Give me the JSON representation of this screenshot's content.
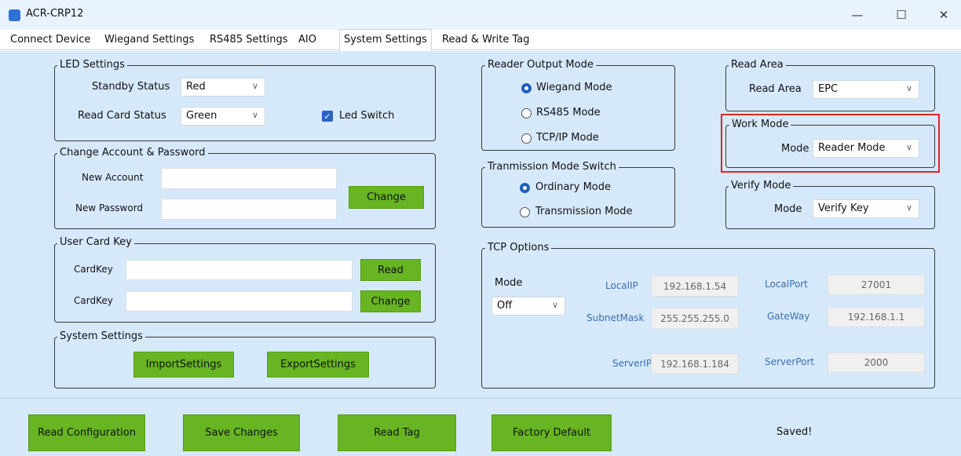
{
  "window": {
    "title": "ACR-CRP12",
    "minimize": "—",
    "maximize": "☐",
    "close": "✕"
  },
  "tabs": [
    "Connect Device",
    "Wiegand Settings",
    "RS485 Settings",
    "AIO",
    "System Settings",
    "Read & Write Tag"
  ],
  "active_tab": "System Settings",
  "led": {
    "title": "LED Settings",
    "standby_label": "Standby Status",
    "standby_value": "Red",
    "read_label": "Read Card Status",
    "read_value": "Green",
    "switch_label": "Led Switch",
    "switch_checked": true
  },
  "account": {
    "title": "Change Account & Password",
    "new_account_label": "New Account",
    "new_account_value": "",
    "new_password_label": "New Password",
    "new_password_value": "",
    "change_button": "Change"
  },
  "cardkey": {
    "title": "User Card Key",
    "label1": "CardKey",
    "value1": "",
    "read_button": "Read",
    "label2": "CardKey",
    "value2": "",
    "change_button": "Change"
  },
  "system": {
    "title": "System Settings",
    "import_button": "ImportSettings",
    "export_button": "ExportSettings"
  },
  "output_mode": {
    "title": "Reader Output Mode",
    "options": [
      "Wiegand Mode",
      "RS485 Mode",
      "TCP/IP Mode"
    ],
    "selected": "Wiegand Mode"
  },
  "transmission": {
    "title": "Tranmission Mode Switch",
    "options": [
      "Ordinary Mode",
      "Transmission Mode"
    ],
    "selected": "Ordinary Mode"
  },
  "read_area": {
    "title": "Read Area",
    "label": "Read Area",
    "value": "EPC"
  },
  "work_mode": {
    "title": "Work Mode",
    "label": "Mode",
    "value": "Reader Mode",
    "highlight_color": "#e0242c"
  },
  "verify_mode": {
    "title": "Verify Mode",
    "label": "Mode",
    "value": "Verify Key"
  },
  "tcp": {
    "title": "TCP Options",
    "mode_label": "Mode",
    "mode_value": "Off",
    "local_ip_label": "LocalIP",
    "local_ip": "192.168.1.54",
    "local_port_label": "LocalPort",
    "local_port": "27001",
    "subnet_label": "SubnetMask",
    "subnet": "255.255.255.0",
    "gateway_label": "GateWay",
    "gateway": "192.168.1.1",
    "server_ip_label": "ServerIP",
    "server_ip": "192.168.1.184",
    "server_port_label": "ServerPort",
    "server_port": "2000"
  },
  "footer": {
    "read_config": "Read Configuration",
    "save_changes": "Save Changes",
    "read_tag": "Read Tag",
    "factory_default": "Factory Default",
    "status": "Saved!"
  },
  "colors": {
    "button_green": "#67b523",
    "panel_bg": "#d6e9fb",
    "label_blue": "#3a6fb0"
  }
}
